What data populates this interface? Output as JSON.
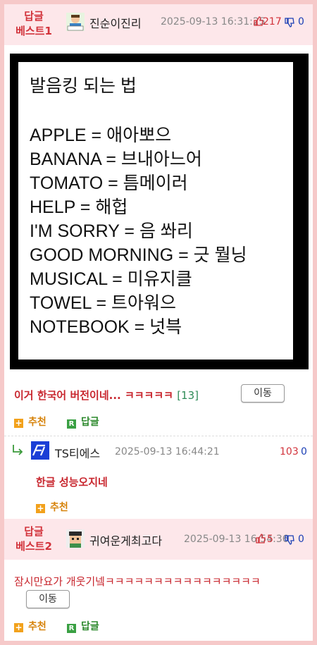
{
  "posts": [
    {
      "badge_line1": "답글",
      "badge_line2": "베스트1",
      "username": "진순이진리",
      "date": "2025-09-13 16:31:25",
      "likes": "217",
      "dislikes": "0",
      "meme": {
        "title": "발음킹 되는 법",
        "lines": [
          "APPLE = 애아뽀으",
          "BANANA = 브내아느어",
          "TOMATO = 틈메이러",
          "HELP = 해헙",
          "I'M SORRY = 음 쏴리",
          "GOOD MORNING = 긋 뭘닝",
          "MUSICAL = 미유지클",
          "TOWEL = 트아워으",
          "NOTEBOOK = 넛븍"
        ]
      },
      "comment": "이거 한국어 버전이네... ㅋㅋㅋㅋㅋ",
      "comment_count": "[13]",
      "move_label": "이동",
      "recommend_label": "추천",
      "reply_label": "답글"
    },
    {
      "username": "TS티에스",
      "date": "2025-09-13 16:44:21",
      "likes": "103",
      "dislikes": "0",
      "comment": "한글 성능오지네",
      "recommend_label": "추천"
    },
    {
      "badge_line1": "답글",
      "badge_line2": "베스트2",
      "username": "귀여운게최고다",
      "date": "2025-09-13 16:54:36",
      "likes": "5",
      "dislikes": "0",
      "comment": "잠시만요가 개웃기넼ㅋㅋㅋㅋㅋㅋㅋㅋㅋㅋㅋㅋㅋㅋㅋㅋ",
      "move_label": "이동",
      "recommend_label": "추천",
      "reply_label": "답글"
    }
  ],
  "colors": {
    "accent_red": "#d2333b",
    "dislike_blue": "#1b3fb5",
    "header_bg": "#fde7ea",
    "border_pink": "#f6c9c9"
  },
  "icons": [
    "thumbs-up-icon",
    "thumbs-down-icon",
    "plus-icon",
    "reply-r-icon",
    "reply-arrow-icon",
    "avatar"
  ]
}
